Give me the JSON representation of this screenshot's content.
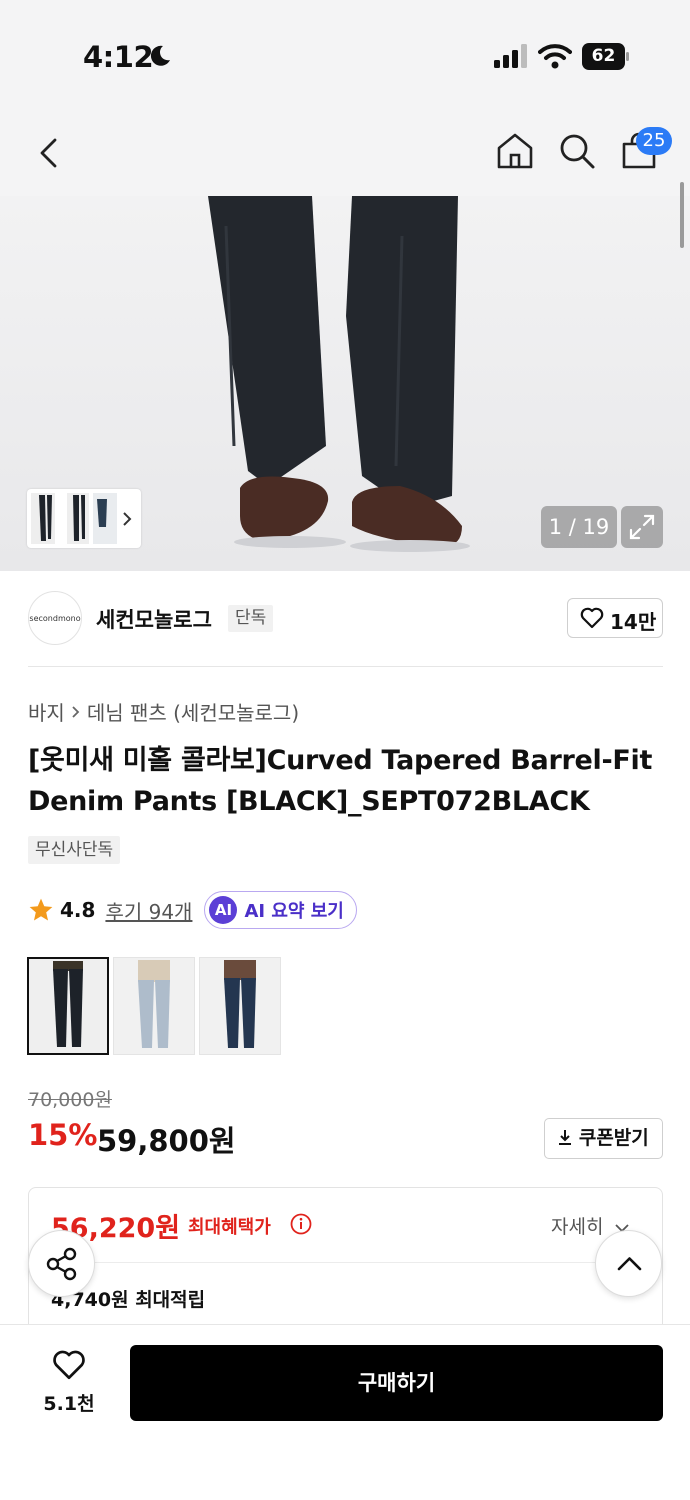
{
  "status_bar": {
    "time": "4:12",
    "battery": "62"
  },
  "nav": {
    "cart_count": "25"
  },
  "gallery": {
    "counter": "1 / 19"
  },
  "brand": {
    "logo_text": "secondmono",
    "name": "세컨모놀로그",
    "tag": "단독",
    "likes": "14만"
  },
  "breadcrumb": {
    "level1": "바지",
    "level2": "데님 팬츠 (세컨모놀로그)"
  },
  "product": {
    "title": "[옷미새 미홀 콜라보]Curved Tapered Barrel-Fit Denim Pants [BLACK]_SEPT072BLACK",
    "exclusive_tag": "무신사단독",
    "rating": "4.8",
    "reviews": "후기 94개",
    "ai_badge": "AI",
    "ai_label": "AI 요약 보기"
  },
  "pricing": {
    "original": "70,000원",
    "discount": "15%",
    "price": "59,800원",
    "coupon": "쿠폰받기",
    "max_benefit_price": "56,220원",
    "max_benefit_label": "최대혜택가",
    "detail": "자세히",
    "points": "4,740원 최대적립"
  },
  "bottom": {
    "wish_count": "5.1천",
    "buy": "구매하기"
  },
  "colors": {
    "accent_red": "#e0231c",
    "badge_blue": "#2b7bf6",
    "ai_purple": "#5b3fd6"
  }
}
